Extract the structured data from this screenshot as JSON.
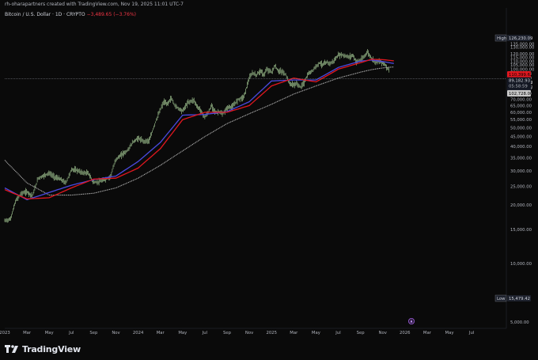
{
  "header": {
    "publisher": "rh-oharapartners created with TradingView.com, Nov 19, 2025 11:01 UTC-7"
  },
  "symbol": {
    "name": "Bitcoin / U.S. Dollar · 1D · CRYPTO",
    "change": "−3,489.65 (−3.76%)"
  },
  "brand": {
    "name": "TradingView"
  },
  "tags": {
    "high_label": "High",
    "high_value": "126,230.09",
    "ma_red": "110,399.62",
    "ma_blue": "106,996.00",
    "ma_blue_sub": "106,000.00",
    "ma_gray": "102,728.00",
    "price": "89,182.93",
    "countdown": "05:58:59",
    "low_label": "Low",
    "low_value": "15,479.42"
  },
  "colors": {
    "background": "#0a0a0a",
    "candles": "#c8f5b4",
    "ma_red": "#e0171f",
    "ma_blue": "#4b4ae0",
    "ma_gray": "#d0d0d0",
    "price_line": "#9598a1"
  },
  "chart_data": {
    "type": "line",
    "y_scale": "log",
    "y_ticks": [
      135000,
      130000,
      120000,
      115000,
      110000,
      105000,
      100000,
      95000,
      90000,
      85000,
      80000,
      75000,
      70000,
      65000,
      60000,
      55000,
      50000,
      45000,
      40000,
      35000,
      30000,
      25000,
      20000,
      15000,
      10000,
      5000
    ],
    "y_tick_labels": [
      "135,000.00",
      "130,000.00",
      "120,000.00",
      "115,000.00",
      "110,000.00",
      "105,000.00",
      "100,000.00",
      "95,000.00",
      "90,000.00",
      "85,000.00",
      "80,000.00",
      "75,000.00",
      "70,000.00",
      "65,000.00",
      "60,000.00",
      "55,000.00",
      "50,000.00",
      "45,000.00",
      "40,000.00",
      "35,000.00",
      "30,000.00",
      "25,000.00",
      "20,000.00",
      "15,000.00",
      "10,000.00",
      "5,000.00"
    ],
    "x_tick_labels": [
      "2023",
      "Mar",
      "May",
      "Jul",
      "Sep",
      "Nov",
      "2024",
      "Mar",
      "May",
      "Jul",
      "Sep",
      "Nov",
      "2025",
      "Mar",
      "May",
      "Jul",
      "Sep",
      "Nov",
      "2026",
      "Mar",
      "May",
      "Jul"
    ],
    "x_tick_months": [
      0,
      2,
      4,
      6,
      8,
      10,
      12,
      14,
      16,
      18,
      20,
      22,
      24,
      26,
      28,
      30,
      32,
      34,
      36,
      38,
      40,
      42
    ],
    "price_line": 89182.93,
    "series": [
      {
        "key": "price",
        "months": [
          0,
          0.5,
          1,
          1.5,
          2,
          2.5,
          3,
          3.5,
          4,
          4.5,
          5,
          5.5,
          6,
          6.5,
          7,
          7.5,
          8,
          8.5,
          9,
          9.5,
          10,
          10.3,
          10.7,
          11,
          11.5,
          12,
          12.5,
          13,
          13.5,
          14,
          14.3,
          14.6,
          15,
          15.3,
          15.6,
          16,
          16.5,
          17,
          17.3,
          17.6,
          18,
          18.3,
          18.6,
          19,
          19.3,
          19.6,
          20,
          20.5,
          21,
          21.5,
          22,
          22.3,
          22.6,
          23,
          23.3,
          23.6,
          24,
          24.3,
          24.6,
          25,
          25.3,
          25.6,
          26,
          26.3,
          26.6,
          27,
          27.3,
          27.6,
          28,
          28.3,
          28.6,
          29,
          29.3,
          29.6,
          30,
          30.3,
          30.6,
          31,
          31.3,
          31.6,
          32,
          32.3,
          32.6,
          33,
          33.3,
          33.6,
          34,
          34.3,
          34.6
        ],
        "values": [
          16600,
          16900,
          21000,
          23000,
          23400,
          22300,
          27500,
          28300,
          29200,
          27800,
          27200,
          26000,
          30500,
          30200,
          29300,
          29200,
          26100,
          26400,
          27000,
          27900,
          34500,
          35500,
          37000,
          37800,
          42000,
          44200,
          42500,
          43000,
          52000,
          62000,
          68000,
          66000,
          71000,
          65000,
          63000,
          61000,
          67500,
          69500,
          64000,
          62000,
          56500,
          60000,
          65000,
          59500,
          60500,
          58500,
          63500,
          64000,
          70000,
          72000,
          89500,
          96000,
          93000,
          98500,
          93000,
          100000,
          96500,
          104000,
          98000,
          97000,
          93000,
          84500,
          83000,
          84500,
          80500,
          87000,
          94500,
          97000,
          103500,
          108000,
          105500,
          108500,
          107000,
          110500,
          118000,
          119000,
          117000,
          115500,
          118500,
          109500,
          111000,
          115500,
          123000,
          114000,
          109000,
          110000,
          108000,
          104000,
          98000,
          94000,
          89200
        ]
      },
      {
        "key": "ma_red",
        "months": [
          0,
          2,
          4,
          6,
          8,
          10,
          12,
          14,
          16,
          18,
          20,
          22,
          24,
          26,
          28,
          30,
          32,
          33,
          34,
          35
        ],
        "values": [
          24000,
          21500,
          21800,
          24500,
          27200,
          27500,
          31000,
          39000,
          55000,
          60000,
          60000,
          65000,
          82000,
          90000,
          86000,
          100000,
          108000,
          112500,
          112000,
          110400
        ]
      },
      {
        "key": "ma_blue",
        "months": [
          0,
          2,
          4,
          6,
          8,
          10,
          12,
          14,
          16,
          18,
          20,
          22,
          24,
          26,
          28,
          30,
          32,
          33,
          34,
          35
        ],
        "values": [
          24500,
          21300,
          23200,
          25300,
          27000,
          28200,
          33500,
          42000,
          58000,
          58500,
          60500,
          68000,
          87000,
          88000,
          88000,
          102000,
          110000,
          111500,
          109500,
          107000
        ]
      },
      {
        "key": "ma_gray",
        "months": [
          0,
          2,
          4,
          6,
          8,
          10,
          12,
          14,
          16,
          18,
          20,
          22,
          24,
          26,
          28,
          30,
          32,
          33,
          34,
          35
        ],
        "values": [
          34000,
          26000,
          22500,
          22500,
          23000,
          24500,
          27500,
          32000,
          38000,
          45000,
          52500,
          59000,
          66000,
          74500,
          82000,
          90000,
          96500,
          99500,
          101500,
          102700
        ]
      }
    ]
  }
}
